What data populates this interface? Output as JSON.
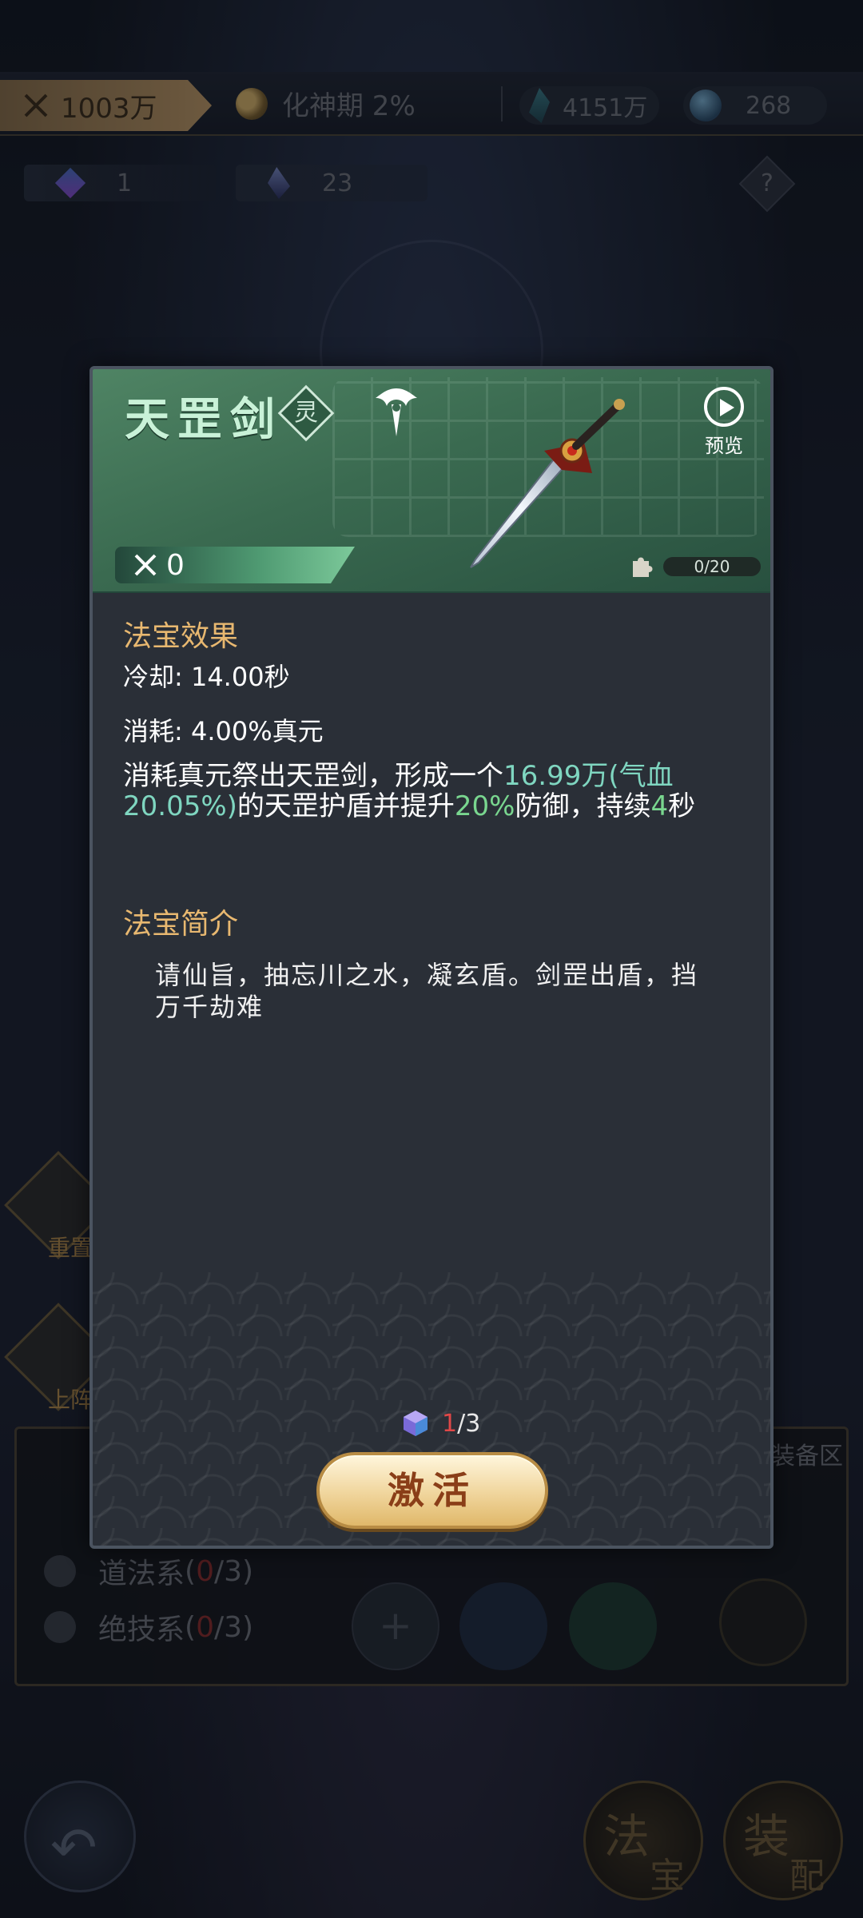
{
  "topbar": {
    "power_value": "1003万",
    "realm_label": "化神期 2%",
    "jade_count": "4151万",
    "orb_count": "268"
  },
  "subbar": {
    "cube_count": "1",
    "shard_count": "23",
    "help_symbol": "?"
  },
  "left_tabs": {
    "tab1_label": "重置",
    "tab2_label": "上阵"
  },
  "series_panel": {
    "reserve_label": "装备区",
    "rows": [
      {
        "label": "道法系",
        "open": " (",
        "current": "0",
        "rest": "/3)"
      },
      {
        "label": "绝技系",
        "open": " (",
        "current": "0",
        "rest": "/3)"
      }
    ],
    "add_symbol": "+"
  },
  "nav": {
    "fabao_big": "法",
    "fabao_small": "宝",
    "peizhi_big": "装",
    "peizhi_small": "配"
  },
  "modal": {
    "item_name": "天罡剑",
    "grade_badge": "灵",
    "preview_label": "预览",
    "power_value": "0",
    "fragments": {
      "text": "0/20",
      "progress": 0
    },
    "effect_section_title": "法宝效果",
    "cooldown_line": "冷却: 14.00秒",
    "cost_line": "消耗: 4.00%真元",
    "desc_part1": "消耗真元祭出天罡剑，形成一个",
    "desc_value1": "16.99万(气血20.05%)",
    "desc_part2": "的天罡护盾并提升",
    "desc_value2": "20%",
    "desc_part3": "防御，持续",
    "desc_value3": "4",
    "desc_part4": "秒",
    "intro_section_title": "法宝简介",
    "intro_text": "请仙旨，抽忘川之水，凝玄盾。剑罡出盾，挡万千劫难",
    "activation_cost": {
      "have": "1",
      "need": "/3"
    },
    "activate_label": "激活"
  },
  "colors": {
    "header_green": "#4f8464",
    "section_title": "#e8b870",
    "highlight_green": "#79d68f",
    "insufficient_red": "#e04848",
    "button_gold": "#f0d59c"
  }
}
